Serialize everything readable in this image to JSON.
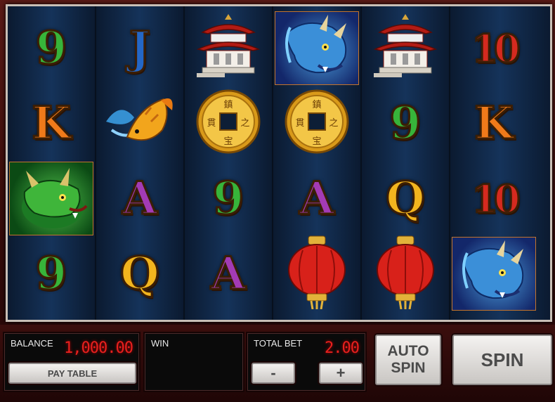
{
  "reels": [
    [
      "9",
      "K",
      "green-dragon-icon",
      "9"
    ],
    [
      "J",
      "koi-fish-icon",
      "A",
      "Q"
    ],
    [
      "pagoda-icon",
      "gold-coin-icon",
      "9",
      "A"
    ],
    [
      "blue-dragon-icon",
      "gold-coin-icon",
      "A",
      "red-lantern-icon"
    ],
    [
      "pagoda-icon",
      "9",
      "Q",
      "red-lantern-icon"
    ],
    [
      "10",
      "K",
      "10",
      "blue-dragon-icon"
    ]
  ],
  "controls": {
    "balance_label": "BALANCE",
    "balance_value": "1,000.00",
    "paytable_label": "PAY TABLE",
    "win_label": "WIN",
    "win_value": "",
    "total_bet_label": "TOTAL BET",
    "total_bet_value": "2.00",
    "minus_label": "-",
    "plus_label": "+",
    "auto_spin_line1": "AUTO",
    "auto_spin_line2": "SPIN",
    "spin_label": "SPIN"
  },
  "colors": {
    "frame": "#3a0d0b",
    "reel_bg": "#15335a",
    "lcd_text": "#e8201e"
  }
}
